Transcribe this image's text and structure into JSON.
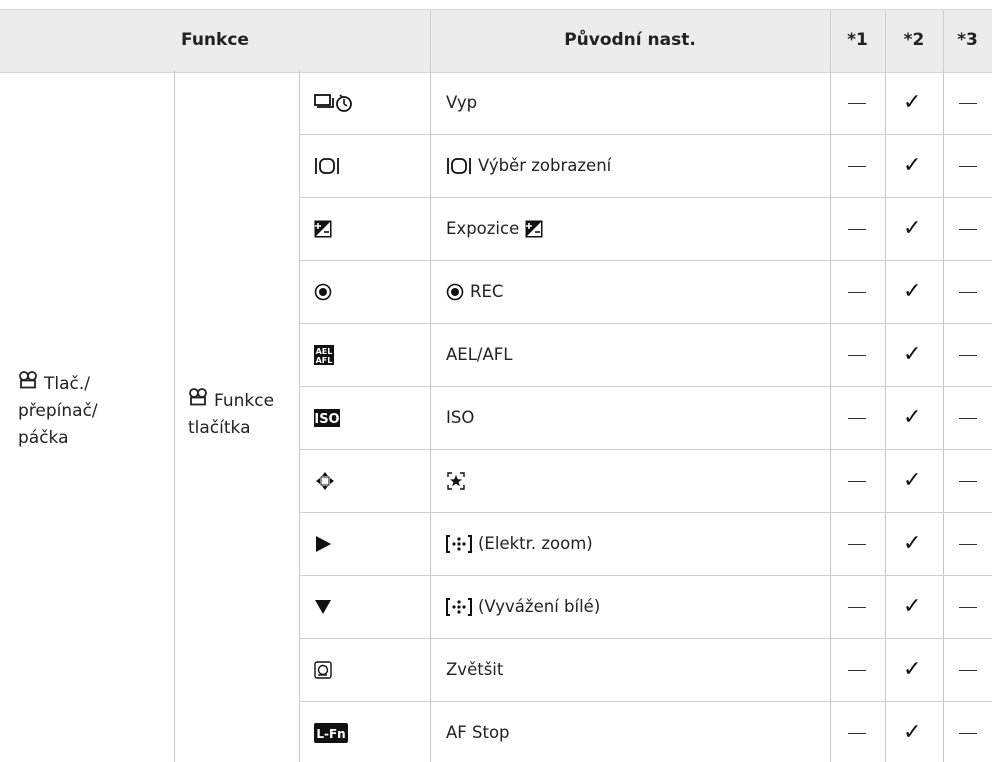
{
  "header": {
    "col_funkce": "Funkce",
    "col_puvodni": "Původní nast.",
    "col_1": "*1",
    "col_2": "*2",
    "col_3": "*3"
  },
  "group1": {
    "icon": "movie-icon",
    "lines": [
      "Tlač./",
      "přepínač/",
      "páčka"
    ]
  },
  "group2": {
    "icon": "movie-icon",
    "lines": [
      "Funkce",
      "tlačítka"
    ]
  },
  "rows": [
    {
      "icon": "sequential-self-timer-icon",
      "value": "Vyp",
      "value_icon": "",
      "c1": "—",
      "c2": "✓",
      "c3": "—"
    },
    {
      "icon": "display-selection-icon",
      "value": "Výběr zobrazení",
      "value_icon": "display-selection-icon",
      "c1": "—",
      "c2": "✓",
      "c3": "—"
    },
    {
      "icon": "exposure-compensation-icon",
      "value": "Expozice",
      "value_icon_after": "exposure-compensation-icon",
      "c1": "—",
      "c2": "✓",
      "c3": "—"
    },
    {
      "icon": "rec-icon",
      "value": "REC",
      "value_icon": "rec-icon",
      "c1": "—",
      "c2": "✓",
      "c3": "—"
    },
    {
      "icon": "ael-afl-icon",
      "value": "AEL/AFL",
      "value_icon": "",
      "c1": "—",
      "c2": "✓",
      "c3": "—"
    },
    {
      "icon": "iso-icon",
      "value": "ISO",
      "value_icon": "",
      "c1": "—",
      "c2": "✓",
      "c3": "—"
    },
    {
      "icon": "arrow-pad-icon",
      "value": "",
      "value_icon": "af-target-icon",
      "c1": "—",
      "c2": "✓",
      "c3": "—"
    },
    {
      "icon": "play-right-icon",
      "value": "(Elektr. zoom)",
      "value_icon": "multi-function-icon",
      "c1": "—",
      "c2": "✓",
      "c3": "—"
    },
    {
      "icon": "down-triangle-icon",
      "value": "(Vyvážení bílé)",
      "value_icon": "multi-function-icon",
      "c1": "—",
      "c2": "✓",
      "c3": "—"
    },
    {
      "icon": "magnify-icon",
      "value": "Zvětšit",
      "value_icon": "",
      "c1": "—",
      "c2": "✓",
      "c3": "—"
    },
    {
      "icon": "l-fn-icon",
      "value": "AF Stop",
      "value_icon": "",
      "c1": "—",
      "c2": "✓",
      "c3": "—"
    }
  ]
}
